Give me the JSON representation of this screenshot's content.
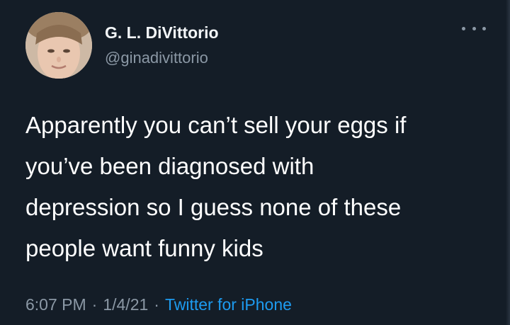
{
  "tweet": {
    "author": {
      "display_name": "G. L. DiVittorio",
      "handle": "@ginadivittorio",
      "avatar_icon": "profile-photo"
    },
    "more_icon": "more-options-icon",
    "text_lines": [
      "Apparently you can’t sell your eggs if",
      "you’ve been diagnosed with",
      "depression so I guess none of these",
      "people want funny kids"
    ],
    "meta": {
      "time": "6:07 PM",
      "separator": "·",
      "date": "1/4/21",
      "source": "Twitter for iPhone"
    }
  },
  "colors": {
    "background": "#141d27",
    "text_primary": "#ffffff",
    "text_secondary": "#8b98a5",
    "link": "#1d9bf0"
  }
}
